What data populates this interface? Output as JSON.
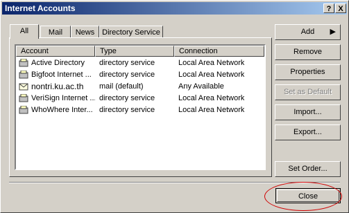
{
  "window": {
    "title": "Internet Accounts",
    "help_label": "?",
    "close_label": "X"
  },
  "tabs": [
    {
      "label": "All",
      "active": true
    },
    {
      "label": "Mail",
      "active": false
    },
    {
      "label": "News",
      "active": false
    },
    {
      "label": "Directory Service",
      "active": false
    }
  ],
  "list": {
    "columns": [
      "Account",
      "Type",
      "Connection"
    ],
    "rows": [
      {
        "account": "Active Directory",
        "type": "directory service",
        "connection": "Local Area Network",
        "icon": "directory-service-icon"
      },
      {
        "account": "Bigfoot Internet ...",
        "type": "directory service",
        "connection": "Local Area Network",
        "icon": "directory-service-icon"
      },
      {
        "account": "nontri.ku.ac.th",
        "type": "mail (default)",
        "connection": "Any Available",
        "icon": "mail-icon"
      },
      {
        "account": "VeriSign Internet ...",
        "type": "directory service",
        "connection": "Local Area Network",
        "icon": "directory-service-icon"
      },
      {
        "account": "WhoWhere Inter...",
        "type": "directory service",
        "connection": "Local Area Network",
        "icon": "directory-service-icon"
      }
    ]
  },
  "buttons": {
    "add": "Add",
    "remove": "Remove",
    "properties": "Properties",
    "set_default": "Set as Default",
    "import": "Import...",
    "export": "Export...",
    "set_order": "Set Order...",
    "close": "Close"
  },
  "colors": {
    "annotation": "#d00000",
    "titlebar": "#0a246a"
  }
}
